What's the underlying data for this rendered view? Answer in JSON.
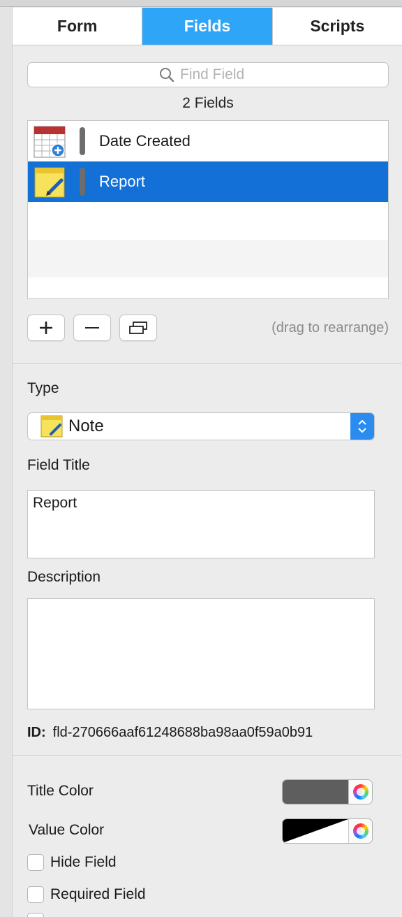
{
  "tabs": [
    {
      "label": "Form",
      "active": false
    },
    {
      "label": "Fields",
      "active": true
    },
    {
      "label": "Scripts",
      "active": false
    }
  ],
  "search": {
    "placeholder": "Find Field",
    "icon": "magnifier-icon"
  },
  "fields_count": "2 Fields",
  "fields": [
    {
      "icon": "calendar-add-icon",
      "label": "Date Created",
      "selected": false
    },
    {
      "icon": "note-pencil-icon",
      "label": "Report",
      "selected": true
    }
  ],
  "list_actions": {
    "add_icon": "plus-icon",
    "remove_icon": "minus-icon",
    "duplicate_icon": "duplicate-icon",
    "hint": "(drag to rearrange)"
  },
  "type_section": {
    "label": "Type",
    "value": "Note",
    "icon": "note-icon"
  },
  "field_title": {
    "label": "Field Title",
    "value": "Report"
  },
  "description": {
    "label": "Description",
    "value": ""
  },
  "id": {
    "label": "ID:",
    "value": "fld-270666aaf61248688ba98aa0f59a0b91"
  },
  "title_color": {
    "label": "Title Color",
    "color": "#5e5e5e"
  },
  "value_color": {
    "label": "Value Color",
    "color": "#000000"
  },
  "checkboxes": [
    {
      "label": "Hide Field",
      "checked": false
    },
    {
      "label": "Required Field",
      "checked": false
    }
  ],
  "colors": {
    "accent": "#2ea5f7",
    "selection": "#1370d6",
    "stepper": "#2a8cf0"
  }
}
